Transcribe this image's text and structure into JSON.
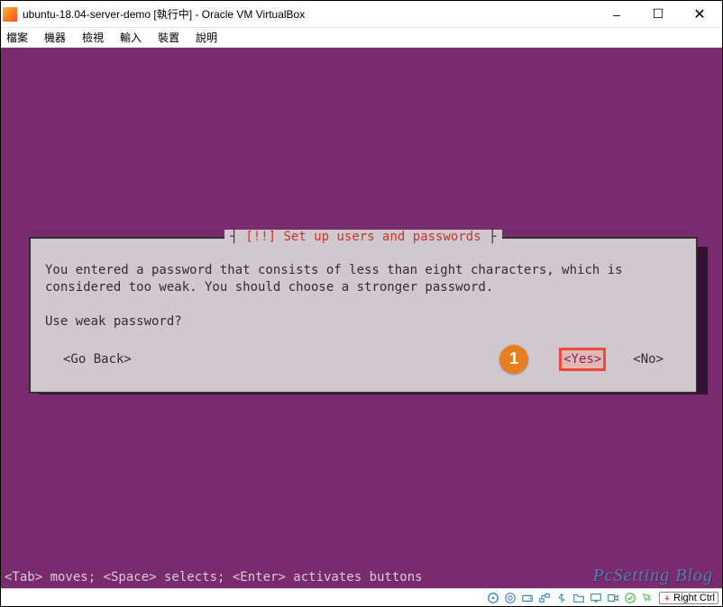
{
  "window": {
    "title": "ubuntu-18.04-server-demo [執行中] - Oracle VM VirtualBox",
    "controls": {
      "minimize": "–",
      "maximize": "☐",
      "close": "✕"
    }
  },
  "menu": {
    "file": "檔案",
    "machine": "機器",
    "view": "檢視",
    "input": "輸入",
    "devices": "裝置",
    "help": "說明"
  },
  "dialog": {
    "title_prefix": "┤ ",
    "title": "[!!] Set up users and passwords",
    "title_suffix": " ├",
    "body": "You entered a password that consists of less than eight characters, which is considered too weak. You should choose a stronger password.",
    "prompt": "Use weak password?",
    "go_back": "<Go Back>",
    "yes": "<Yes>",
    "no": "<No>"
  },
  "callout": {
    "number": "1"
  },
  "hint": "<Tab> moves; <Space> selects; <Enter> activates buttons",
  "watermark": "PcSetting Blog",
  "status": {
    "hostkey": "Right Ctrl"
  }
}
